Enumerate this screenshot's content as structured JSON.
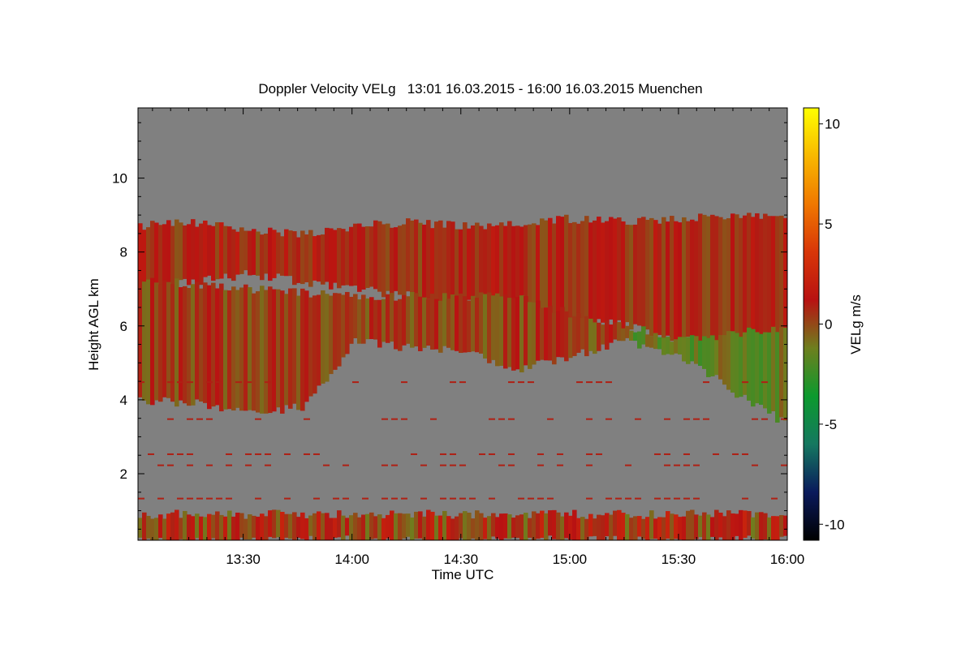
{
  "chart_data": {
    "type": "heatmap",
    "title": "Doppler Velocity VELg   13:01 16.03.2015 - 16:00 16.03.2015 Muenchen",
    "xlabel": "Time UTC",
    "ylabel": "Height AGL km",
    "colorbar_label": "VELg m/s",
    "xlim": [
      "13:01",
      "16:00"
    ],
    "ylim": [
      0.2,
      11.9
    ],
    "x_ticks": [
      {
        "label": "13:30",
        "minute": 810
      },
      {
        "label": "14:00",
        "minute": 840
      },
      {
        "label": "14:30",
        "minute": 870
      },
      {
        "label": "15:00",
        "minute": 900
      },
      {
        "label": "15:30",
        "minute": 930
      },
      {
        "label": "16:00",
        "minute": 960
      }
    ],
    "y_ticks": [
      2,
      4,
      6,
      8,
      10
    ],
    "colorbar_range": [
      -10.8,
      10.8
    ],
    "colorbar_ticks": [
      -10,
      -5,
      0,
      5,
      10
    ],
    "colorscale": [
      "#000000",
      "#0a1a5c",
      "#157860",
      "#0c9a2e",
      "#6e7f1e",
      "#b81212",
      "#d83608",
      "#f07800",
      "#f8b800",
      "#ffff00"
    ],
    "background_color": "#808080",
    "grid": false,
    "echo_layers": [
      {
        "name": "upper",
        "description": "cloud layer",
        "base_km": [
          7.0,
          7.2,
          7.4,
          7.2,
          7.0,
          6.8,
          6.6,
          6.4,
          6.2,
          6.0,
          5.6,
          5.5,
          4.8
        ],
        "top_km": [
          8.7,
          8.8,
          8.6,
          8.5,
          8.7,
          8.8,
          8.7,
          8.8,
          8.9,
          8.8,
          8.9,
          9.0,
          8.9
        ]
      },
      {
        "name": "middle",
        "description": "precipitation streaks",
        "base_km": [
          4.0,
          3.9,
          3.6,
          3.8,
          5.6,
          5.4,
          5.3,
          4.8,
          5.2,
          5.6,
          5.2,
          4.2,
          3.3
        ],
        "top_km": [
          7.3,
          7.1,
          7.0,
          6.9,
          6.8,
          6.8,
          6.8,
          6.8,
          6.3,
          6.0,
          5.6,
          5.8,
          6.0
        ]
      },
      {
        "name": "boundary",
        "description": "near-surface echoes",
        "base_km": 0.2,
        "top_km": 0.9
      }
    ]
  }
}
